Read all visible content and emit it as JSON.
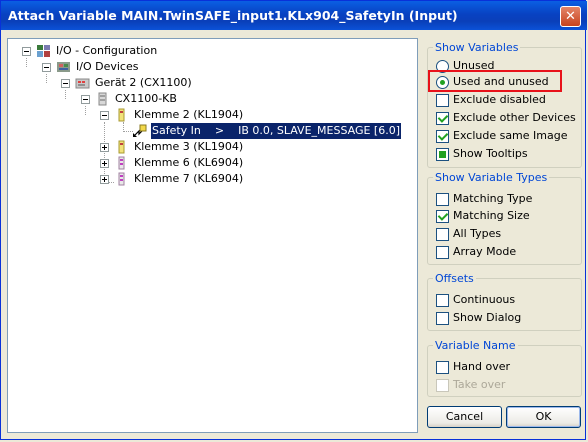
{
  "window": {
    "title": "Attach Variable MAIN.TwinSAFE_input1.KLx904_SafetyIn (Input)",
    "close_glyph": "✕"
  },
  "tree": {
    "root": "I/O - Configuration",
    "io_devices": "I/O Devices",
    "device": "Gerät 2 (CX1100)",
    "kb": "CX1100-KB",
    "klemme2": "Klemme 2 (KL1904)",
    "safety_var": "Safety In    >    IB 0.0, SLAVE_MESSAGE [6.0]",
    "klemme3": "Klemme 3 (KL1904)",
    "klemme6": "Klemme 6 (KL6904)",
    "klemme7": "Klemme 7 (KL6904)"
  },
  "show_variables": {
    "title": "Show Variables",
    "unused": "Unused",
    "used_and_unused": "Used and unused",
    "exclude_disabled": "Exclude disabled",
    "exclude_other_devices": "Exclude other Devices",
    "exclude_same_image": "Exclude same Image",
    "show_tooltips": "Show Tooltips"
  },
  "show_variable_types": {
    "title": "Show Variable Types",
    "matching_type": "Matching Type",
    "matching_size": "Matching Size",
    "all_types": "All Types",
    "array_mode": "Array Mode"
  },
  "offsets": {
    "title": "Offsets",
    "continuous": "Continuous",
    "show_dialog": "Show Dialog"
  },
  "variable_name": {
    "title": "Variable Name",
    "hand_over": "Hand over",
    "take_over": "Take over"
  },
  "buttons": {
    "cancel": "Cancel",
    "ok": "OK"
  },
  "colors": {
    "titlebar": "#0842C2",
    "group_title": "#0046D5",
    "selection": "#0A246A",
    "highlight": "#E8121A",
    "check": "#21A121"
  }
}
